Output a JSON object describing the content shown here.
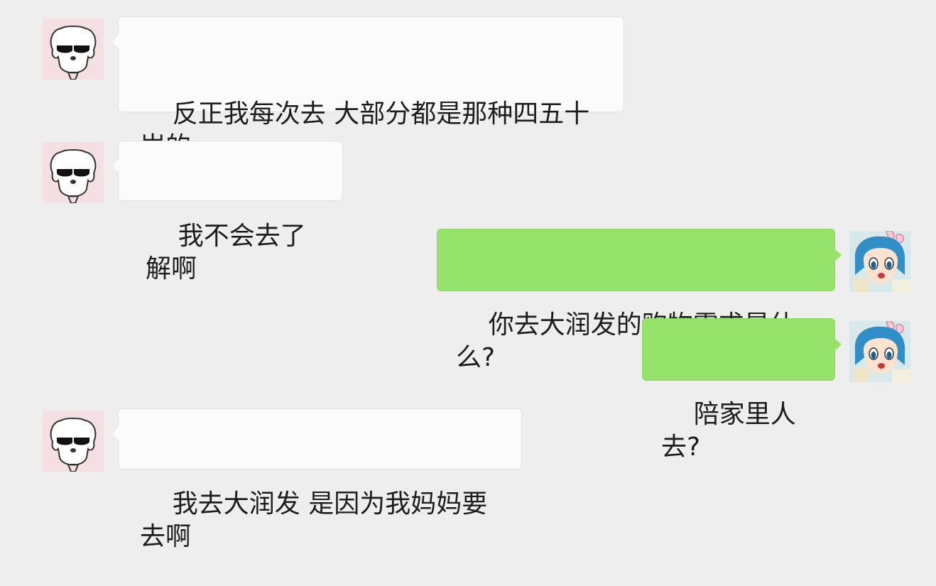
{
  "messages": [
    {
      "side": "in",
      "text": "反正我每次去 大部分都是那种四五十岁的\n在排队买单"
    },
    {
      "side": "in",
      "text": "我不会去了解啊"
    },
    {
      "side": "out",
      "text": "你去大润发的购物需求是什么?"
    },
    {
      "side": "out",
      "text": "陪家里人去?"
    },
    {
      "side": "in",
      "text": "我去大润发 是因为我妈妈要去啊"
    }
  ],
  "avatars": {
    "incoming": "dog-with-sunglasses-avatar",
    "outgoing": "anime-girl-with-bunny-ears-avatar"
  },
  "colors": {
    "background": "#eeeeee",
    "incoming_bubble": "#fbfbfb",
    "outgoing_bubble": "#95e36b"
  }
}
